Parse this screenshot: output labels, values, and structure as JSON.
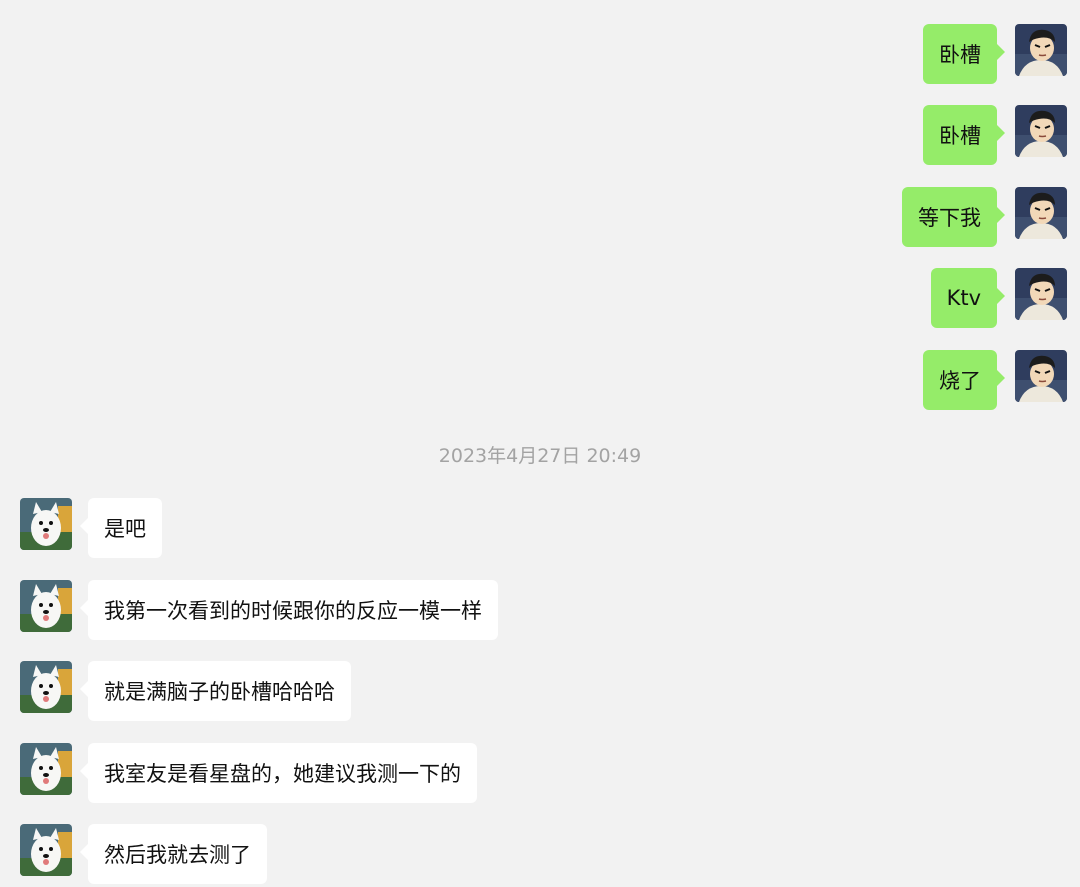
{
  "sent_messages": [
    {
      "text": "卧槽"
    },
    {
      "text": "卧槽"
    },
    {
      "text": "等下我"
    },
    {
      "text": "Ktv"
    },
    {
      "text": "烧了"
    }
  ],
  "timestamp": "2023年4月27日 20:49",
  "received_messages": [
    {
      "text": "是吧"
    },
    {
      "text": "我第一次看到的时候跟你的反应一模一样"
    },
    {
      "text": "就是满脑子的卧槽哈哈哈"
    },
    {
      "text": "我室友是看星盘的，她建议我测一下的"
    },
    {
      "text": "然后我就去测了"
    }
  ],
  "colors": {
    "background": "#f2f2f2",
    "sent_bubble": "#95ec69",
    "received_bubble": "#ffffff",
    "timestamp_text": "#a3a3a3"
  },
  "icons": {
    "self_avatar": "cartoon-man-avatar",
    "other_avatar": "white-dog-avatar"
  }
}
